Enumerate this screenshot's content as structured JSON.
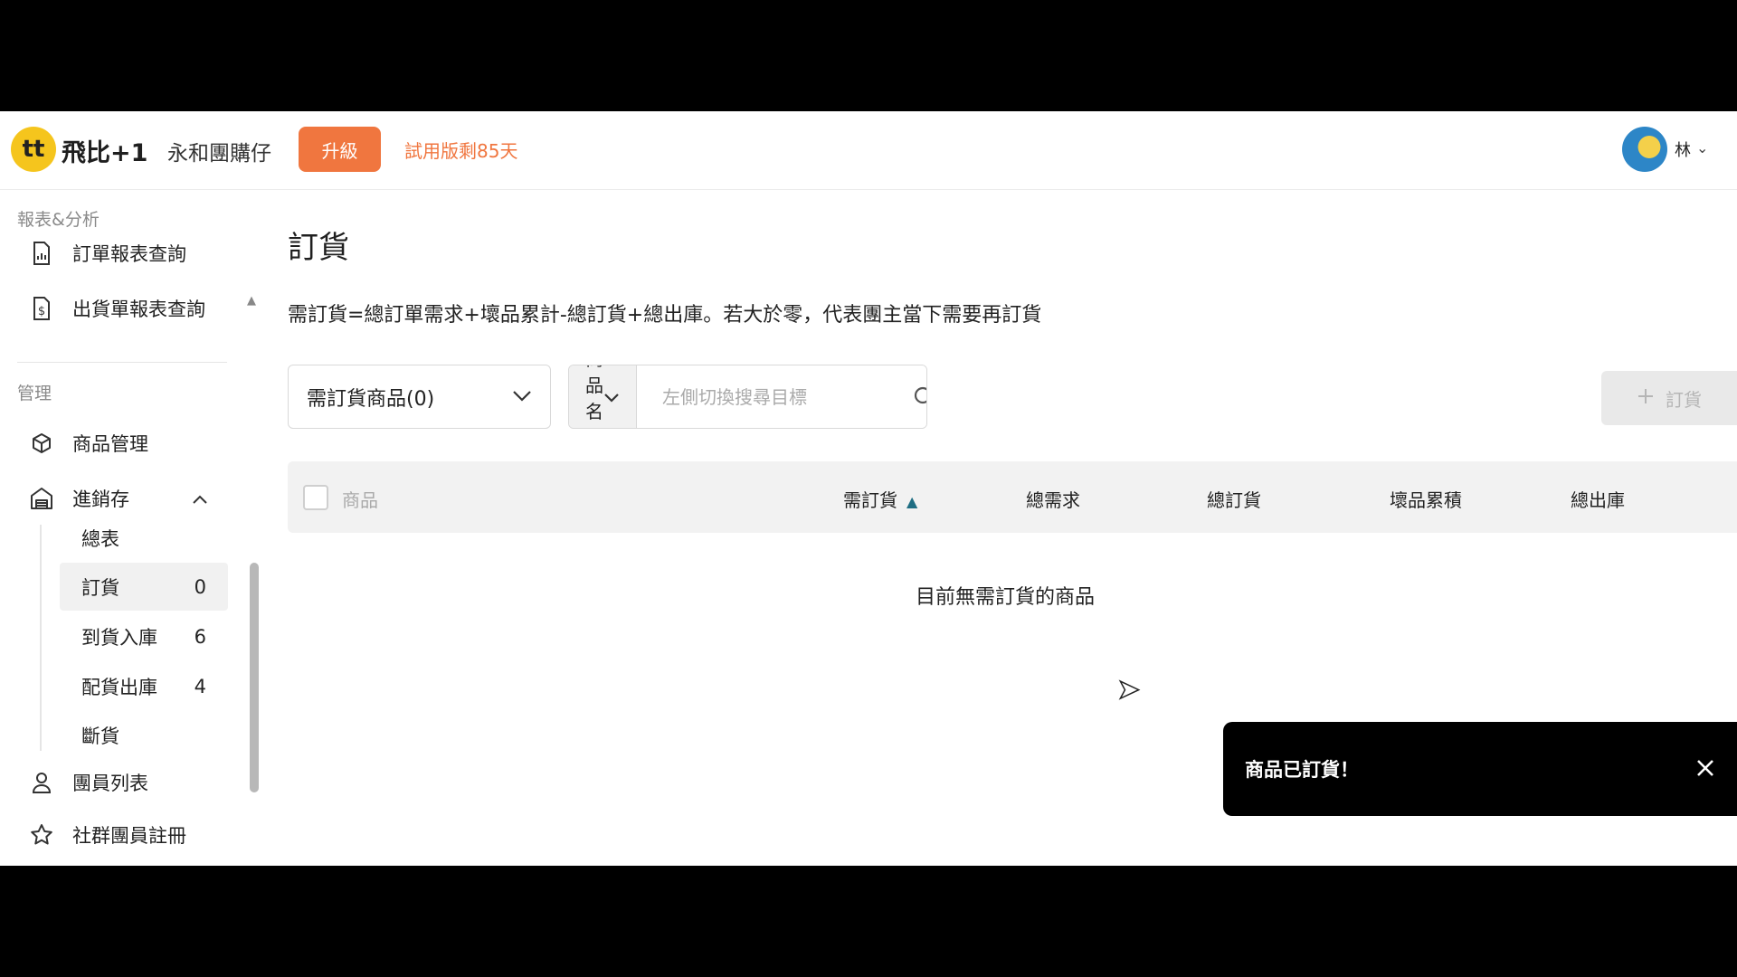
{
  "header": {
    "logo_text": "tt",
    "brand": "飛比+1",
    "shop_name": "永和團購仔",
    "upgrade_label": "升級",
    "trial_text": "試用版剩85天",
    "user_name": "林",
    "user_chevron": "⌄"
  },
  "sidebar": {
    "reports_title": "報表&分析",
    "order_report": "訂單報表查詢",
    "shipment_report": "出貨單報表查詢",
    "manage_title": "管理",
    "product_mgmt": "商品管理",
    "inventory": "進銷存",
    "sub_items": [
      {
        "label": "總表",
        "count": ""
      },
      {
        "label": "訂貨",
        "count": "0"
      },
      {
        "label": "到貨入庫",
        "count": "6"
      },
      {
        "label": "配貨出庫",
        "count": "4"
      },
      {
        "label": "斷貨",
        "count": ""
      }
    ],
    "members": "團員列表",
    "community": "社群團員註冊"
  },
  "main": {
    "title": "訂貨",
    "formula": "需訂貨=總訂單需求+壞品累計-總訂貨+總出庫。若大於零，代表團主當下需要再訂貨",
    "filter_value": "需訂貨商品(0)",
    "search_type": "商品名稱",
    "search_placeholder": "左側切換搜尋目標",
    "order_button": "訂貨",
    "columns": {
      "product": "商品",
      "need_order": "需訂貨",
      "total_demand": "總需求",
      "total_ordered": "總訂貨",
      "damaged": "壞品累積",
      "total_out": "總出庫"
    },
    "empty_text": "目前無需訂貨的商品"
  },
  "toast": {
    "message": "商品已訂貨！"
  },
  "colors": {
    "accent": "#f0763f",
    "logo_yellow": "#f5c51d",
    "sort_icon": "#1f6e83"
  }
}
